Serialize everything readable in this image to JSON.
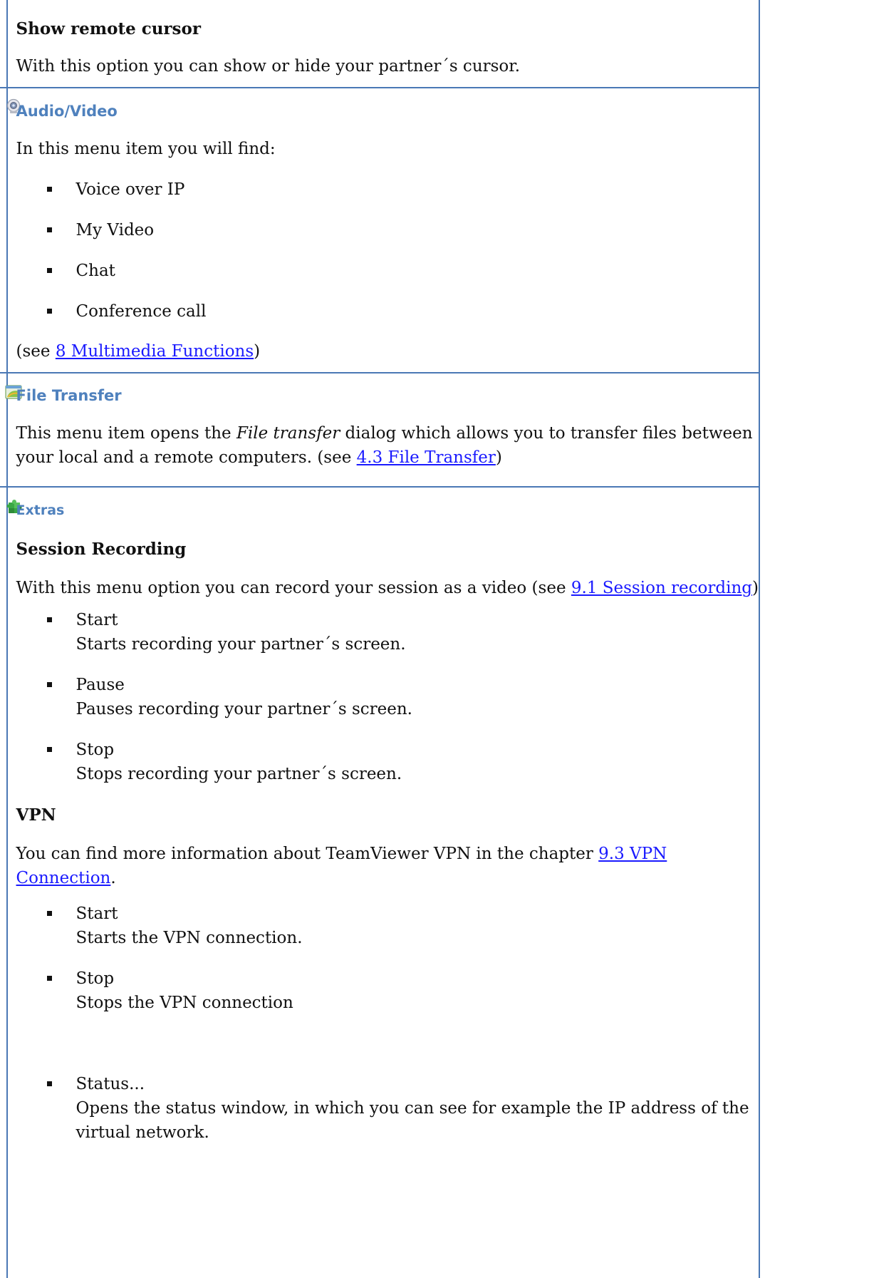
{
  "rows": {
    "cursor": {
      "title": "Show remote cursor",
      "desc": "With this option you can show or hide your partner´s cursor."
    },
    "audio": {
      "title": "Audio/Video",
      "intro": "In this menu item you will find:",
      "items": [
        "Voice over IP",
        "My Video",
        "Chat",
        "Conference call"
      ],
      "see_pre": "(see ",
      "see_link": "8 Multimedia Functions",
      "see_post": ")",
      "icon": "webcam-icon"
    },
    "file": {
      "title": "File Transfer",
      "desc_pre": "This menu item opens  the ",
      "desc_italic": "File transfer",
      "desc_post": " dialog which allows you to transfer files between",
      "line2_pre": "your local and a remote computers. (see ",
      "line2_link": "4.3 File Transfer",
      "line2_post": ")",
      "icon": "file-transfer-icon"
    },
    "extras": {
      "title": "Extras",
      "icon": "puzzle-icon",
      "recording": {
        "title": "Session Recording",
        "desc_pre": "With this menu option you can record your session as a video (see ",
        "desc_link": "9.1 Session recording",
        "desc_post": ")",
        "items": [
          {
            "label": "Start",
            "desc": "Starts recording your partner´s screen."
          },
          {
            "label": "Pause",
            "desc": "Pauses recording your partner´s screen."
          },
          {
            "label": "Stop",
            "desc": "Stops recording your partner´s screen."
          }
        ]
      },
      "vpn": {
        "title": "VPN",
        "desc_pre": "You can find more information about TeamViewer VPN in the chapter ",
        "desc_link1": "9.3 VPN",
        "desc_link2": "Connection",
        "desc_post": ".",
        "items": [
          {
            "label": "Start",
            "desc": "Starts the VPN connection."
          },
          {
            "label": "Stop",
            "desc": "Stops the VPN connection"
          }
        ],
        "status": {
          "label": "Status...",
          "desc1": "Opens the status window, in which you can see for example the IP address of the",
          "desc2": "virtual network."
        }
      }
    }
  },
  "colors": {
    "border": "#4a78b5",
    "heading": "#4f81bd",
    "link": "#1a1aff"
  }
}
